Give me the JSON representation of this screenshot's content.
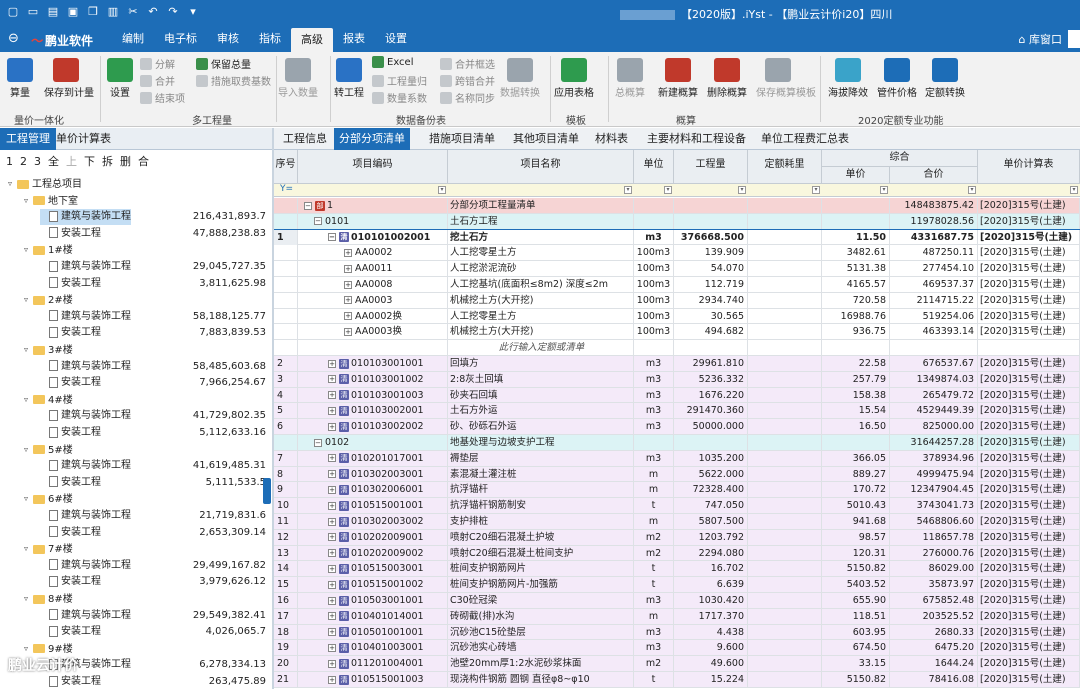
{
  "titlebar": {
    "title": "【2020版】.iYst - 【鹏业云计价i20】四川"
  },
  "menubar": {
    "logo": "鹏业软件",
    "tabs": [
      "编制",
      "电子标",
      "审核",
      "指标",
      "高级",
      "报表",
      "设置"
    ],
    "active_tab": "高级",
    "home_label": "库窗口"
  },
  "ribbon": {
    "buttons": [
      {
        "label": "算量",
        "icon": "calc-icon",
        "color": "#2a72c5"
      },
      {
        "label": "保存到计量",
        "icon": "save-to-measure-icon",
        "color": "#c0392b"
      },
      {
        "label": "设置",
        "icon": "settings-plus-icon",
        "color": "#2e9b4e"
      },
      {
        "label": "导入数量",
        "icon": "import-quantity-icon",
        "color": "#9aa4ad"
      },
      {
        "label": "转工程",
        "icon": "convert-project-icon",
        "color": "#2a72c5"
      },
      {
        "label": "数据转换",
        "icon": "data-convert-icon",
        "color": "#9aa4ad"
      },
      {
        "label": "应用表格",
        "icon": "apply-table-icon",
        "color": "#2e9b4e"
      },
      {
        "label": "总概算",
        "icon": "total-estimate-icon",
        "color": "#9aa4ad"
      },
      {
        "label": "新建概算",
        "icon": "new-estimate-icon",
        "color": "#c0392b"
      },
      {
        "label": "删除概算",
        "icon": "delete-estimate-icon",
        "color": "#c0392b"
      },
      {
        "label": "保存概算模板",
        "icon": "save-estimate-template-icon",
        "color": "#9aa4ad"
      },
      {
        "label": "海拔降效",
        "icon": "altitude-icon",
        "color": "#3aa3c9"
      },
      {
        "label": "管件价格",
        "icon": "pipe-price-icon",
        "color": "#1d6db7"
      },
      {
        "label": "定额转换",
        "icon": "quota-convert-icon",
        "color": "#1d6db7"
      }
    ],
    "small": [
      {
        "label": "分解",
        "enabled": false
      },
      {
        "label": "合并",
        "enabled": false
      },
      {
        "label": "结束项",
        "enabled": false
      },
      {
        "label": "保留总量",
        "enabled": true
      },
      {
        "label": "措施取费基数",
        "enabled": false
      },
      {
        "label": "Excel",
        "enabled": true
      },
      {
        "label": "工程量归",
        "enabled": false
      },
      {
        "label": "数量系数",
        "enabled": false
      },
      {
        "label": "合并框选",
        "enabled": false
      },
      {
        "label": "跨错合并",
        "enabled": false
      },
      {
        "label": "名称同步",
        "enabled": false
      }
    ],
    "groups": [
      "量价一体化",
      "多工程量",
      "数据备份表",
      "模板",
      "概算",
      "2020定额专业功能"
    ]
  },
  "left": {
    "tabs": [
      "工程管理",
      "单价计算表"
    ],
    "toolbar": [
      "1",
      "2",
      "3",
      "全",
      "上",
      "下",
      "拆",
      "删",
      "合"
    ],
    "tree": [
      {
        "level": 0,
        "label": "工程总项目",
        "type": "folder",
        "value": ""
      },
      {
        "level": 1,
        "label": "地下室",
        "type": "folder",
        "value": ""
      },
      {
        "level": 2,
        "label": "建筑与装饰工程",
        "type": "file",
        "value": "216,431,893.7",
        "selected": true
      },
      {
        "level": 2,
        "label": "安装工程",
        "type": "file",
        "value": "47,888,238.83"
      },
      {
        "level": 1,
        "label": "1#楼",
        "type": "folder",
        "value": ""
      },
      {
        "level": 2,
        "label": "建筑与装饰工程",
        "type": "file",
        "value": "29,045,727.35"
      },
      {
        "level": 2,
        "label": "安装工程",
        "type": "file",
        "value": "3,811,625.98"
      },
      {
        "level": 1,
        "label": "2#楼",
        "type": "folder",
        "value": ""
      },
      {
        "level": 2,
        "label": "建筑与装饰工程",
        "type": "file",
        "value": "58,188,125.77"
      },
      {
        "level": 2,
        "label": "安装工程",
        "type": "file",
        "value": "7,883,839.53"
      },
      {
        "level": 1,
        "label": "3#楼",
        "type": "folder",
        "value": ""
      },
      {
        "level": 2,
        "label": "建筑与装饰工程",
        "type": "file",
        "value": "58,485,603.68"
      },
      {
        "level": 2,
        "label": "安装工程",
        "type": "file",
        "value": "7,966,254.67"
      },
      {
        "level": 1,
        "label": "4#楼",
        "type": "folder",
        "value": ""
      },
      {
        "level": 2,
        "label": "建筑与装饰工程",
        "type": "file",
        "value": "41,729,802.35"
      },
      {
        "level": 2,
        "label": "安装工程",
        "type": "file",
        "value": "5,112,633.16"
      },
      {
        "level": 1,
        "label": "5#楼",
        "type": "folder",
        "value": ""
      },
      {
        "level": 2,
        "label": "建筑与装饰工程",
        "type": "file",
        "value": "41,619,485.31"
      },
      {
        "level": 2,
        "label": "安装工程",
        "type": "file",
        "value": "5,111,533.5"
      },
      {
        "level": 1,
        "label": "6#楼",
        "type": "folder",
        "value": ""
      },
      {
        "level": 2,
        "label": "建筑与装饰工程",
        "type": "file",
        "value": "21,719,831.6"
      },
      {
        "level": 2,
        "label": "安装工程",
        "type": "file",
        "value": "2,653,309.14"
      },
      {
        "level": 1,
        "label": "7#楼",
        "type": "folder",
        "value": ""
      },
      {
        "level": 2,
        "label": "建筑与装饰工程",
        "type": "file",
        "value": "29,499,167.82"
      },
      {
        "level": 2,
        "label": "安装工程",
        "type": "file",
        "value": "3,979,626.12"
      },
      {
        "level": 1,
        "label": "8#楼",
        "type": "folder",
        "value": ""
      },
      {
        "level": 2,
        "label": "建筑与装饰工程",
        "type": "file",
        "value": "29,549,382.41"
      },
      {
        "level": 2,
        "label": "安装工程",
        "type": "file",
        "value": "4,026,065.7"
      },
      {
        "level": 1,
        "label": "9#楼",
        "type": "folder",
        "value": ""
      },
      {
        "level": 2,
        "label": "建筑与装饰工程",
        "type": "file",
        "value": "6,278,334.13"
      },
      {
        "level": 2,
        "label": "安装工程",
        "type": "file",
        "value": "263,475.89"
      }
    ]
  },
  "grid": {
    "tabs": [
      "工程信息",
      "分部分项清单",
      "措施项目清单",
      "其他项目清单",
      "材料表",
      "主要材料和工程设备",
      "单位工程费汇总表"
    ],
    "active_tab": "分部分项清单",
    "headers": {
      "seq": "序号",
      "code": "项目编码",
      "name": "项目名称",
      "unit": "单位",
      "qty": "工程量",
      "quota": "定额耗里",
      "synth": "综合",
      "unit_price": "单价",
      "total": "合价",
      "calc": "单价计算表"
    },
    "rows": [
      {
        "seq": "",
        "code": "1",
        "name": "分部分项工程量清单",
        "unit": "",
        "qty": "",
        "price": "",
        "total": "148483875.42",
        "calc": "[2020]315号(土建)",
        "kind": "root"
      },
      {
        "seq": "",
        "code": "0101",
        "name": "土石方工程",
        "unit": "",
        "qty": "",
        "price": "",
        "total": "11978028.56",
        "calc": "[2020]315号(土建)",
        "kind": "section"
      },
      {
        "seq": "1",
        "code": "010101002001",
        "name": "挖土石方",
        "unit": "m3",
        "qty": "376668.500",
        "price": "11.50",
        "total": "4331687.75",
        "calc": "[2020]315号(土建)",
        "kind": "current"
      },
      {
        "seq": "",
        "code": "AA0002",
        "name": "人工挖零星土方",
        "unit": "100m3",
        "qty": "139.909",
        "price": "3482.61",
        "total": "487250.11",
        "calc": "[2020]315号(土建)",
        "kind": "sub"
      },
      {
        "seq": "",
        "code": "AA0011",
        "name": "人工挖淤泥流砂",
        "unit": "100m3",
        "qty": "54.070",
        "price": "5131.38",
        "total": "277454.10",
        "calc": "[2020]315号(土建)",
        "kind": "sub"
      },
      {
        "seq": "",
        "code": "AA0008",
        "name": "人工挖基坑(底面积≤8m2) 深度≤2m",
        "unit": "100m3",
        "qty": "112.719",
        "price": "4165.57",
        "total": "469537.37",
        "calc": "[2020]315号(土建)",
        "kind": "sub"
      },
      {
        "seq": "",
        "code": "AA0003",
        "name": "机械挖土方(大开挖)",
        "unit": "100m3",
        "qty": "2934.740",
        "price": "720.58",
        "total": "2114715.22",
        "calc": "[2020]315号(土建)",
        "kind": "sub"
      },
      {
        "seq": "",
        "code": "AA0002换",
        "name": "人工挖零星土方",
        "unit": "100m3",
        "qty": "30.565",
        "price": "16988.76",
        "total": "519254.06",
        "calc": "[2020]315号(土建)",
        "kind": "sub"
      },
      {
        "seq": "",
        "code": "AA0003换",
        "name": "机械挖土方(大开挖)",
        "unit": "100m3",
        "qty": "494.682",
        "price": "936.75",
        "total": "463393.14",
        "calc": "[2020]315号(土建)",
        "kind": "sub"
      },
      {
        "seq": "",
        "code": "",
        "name": "此行输入定额或清单",
        "unit": "",
        "qty": "",
        "price": "",
        "total": "",
        "calc": "",
        "kind": "input"
      },
      {
        "seq": "2",
        "code": "010103001001",
        "name": "回填方",
        "unit": "m3",
        "qty": "29961.810",
        "price": "22.58",
        "total": "676537.67",
        "calc": "[2020]315号(土建)",
        "kind": "item"
      },
      {
        "seq": "3",
        "code": "010103001002",
        "name": "2:8灰土回填",
        "unit": "m3",
        "qty": "5236.332",
        "price": "257.79",
        "total": "1349874.03",
        "calc": "[2020]315号(土建)",
        "kind": "item"
      },
      {
        "seq": "4",
        "code": "010103001003",
        "name": "砂夹石回填",
        "unit": "m3",
        "qty": "1676.220",
        "price": "158.38",
        "total": "265479.72",
        "calc": "[2020]315号(土建)",
        "kind": "item"
      },
      {
        "seq": "5",
        "code": "010103002001",
        "name": "土石方外运",
        "unit": "m3",
        "qty": "291470.360",
        "price": "15.54",
        "total": "4529449.39",
        "calc": "[2020]315号(土建)",
        "kind": "item"
      },
      {
        "seq": "6",
        "code": "010103002002",
        "name": "砂、砂砾石外运",
        "unit": "m3",
        "qty": "50000.000",
        "price": "16.50",
        "total": "825000.00",
        "calc": "[2020]315号(土建)",
        "kind": "item"
      },
      {
        "seq": "",
        "code": "0102",
        "name": "地基处理与边坡支护工程",
        "unit": "",
        "qty": "",
        "price": "",
        "total": "31644257.28",
        "calc": "[2020]315号(土建)",
        "kind": "section"
      },
      {
        "seq": "7",
        "code": "010201017001",
        "name": "褥垫层",
        "unit": "m3",
        "qty": "1035.200",
        "price": "366.05",
        "total": "378934.96",
        "calc": "[2020]315号(土建)",
        "kind": "item"
      },
      {
        "seq": "8",
        "code": "010302003001",
        "name": "素混凝土灌注桩",
        "unit": "m",
        "qty": "5622.000",
        "price": "889.27",
        "total": "4999475.94",
        "calc": "[2020]315号(土建)",
        "kind": "item"
      },
      {
        "seq": "9",
        "code": "010302006001",
        "name": "抗浮锚杆",
        "unit": "m",
        "qty": "72328.400",
        "price": "170.72",
        "total": "12347904.45",
        "calc": "[2020]315号(土建)",
        "kind": "item"
      },
      {
        "seq": "10",
        "code": "010515001001",
        "name": "抗浮锚杆钢筋制安",
        "unit": "t",
        "qty": "747.050",
        "price": "5010.43",
        "total": "3743041.73",
        "calc": "[2020]315号(土建)",
        "kind": "item"
      },
      {
        "seq": "11",
        "code": "010302003002",
        "name": "支护排桩",
        "unit": "m",
        "qty": "5807.500",
        "price": "941.68",
        "total": "5468806.60",
        "calc": "[2020]315号(土建)",
        "kind": "item"
      },
      {
        "seq": "12",
        "code": "010202009001",
        "name": "喷射C20细石混凝土护坡",
        "unit": "m2",
        "qty": "1203.792",
        "price": "98.57",
        "total": "118657.78",
        "calc": "[2020]315号(土建)",
        "kind": "item"
      },
      {
        "seq": "13",
        "code": "010202009002",
        "name": "喷射C20细石混凝土桩间支护",
        "unit": "m2",
        "qty": "2294.080",
        "price": "120.31",
        "total": "276000.76",
        "calc": "[2020]315号(土建)",
        "kind": "item"
      },
      {
        "seq": "14",
        "code": "010515003001",
        "name": "桩间支护钢筋网片",
        "unit": "t",
        "qty": "16.702",
        "price": "5150.82",
        "total": "86029.00",
        "calc": "[2020]315号(土建)",
        "kind": "item"
      },
      {
        "seq": "15",
        "code": "010515001002",
        "name": "桩间支护钢筋网片-加强筋",
        "unit": "t",
        "qty": "6.639",
        "price": "5403.52",
        "total": "35873.97",
        "calc": "[2020]315号(土建)",
        "kind": "item"
      },
      {
        "seq": "16",
        "code": "010503001001",
        "name": "C30砼冠梁",
        "unit": "m3",
        "qty": "1030.420",
        "price": "655.90",
        "total": "675852.48",
        "calc": "[2020]315号(土建)",
        "kind": "item"
      },
      {
        "seq": "17",
        "code": "010401014001",
        "name": "砖砌截(排)水沟",
        "unit": "m",
        "qty": "1717.370",
        "price": "118.51",
        "total": "203525.52",
        "calc": "[2020]315号(土建)",
        "kind": "item"
      },
      {
        "seq": "18",
        "code": "010501001001",
        "name": "沉砂池C15砼垫层",
        "unit": "m3",
        "qty": "4.438",
        "price": "603.95",
        "total": "2680.33",
        "calc": "[2020]315号(土建)",
        "kind": "item"
      },
      {
        "seq": "19",
        "code": "010401003001",
        "name": "沉砂池实心砖墙",
        "unit": "m3",
        "qty": "9.600",
        "price": "674.50",
        "total": "6475.20",
        "calc": "[2020]315号(土建)",
        "kind": "item"
      },
      {
        "seq": "20",
        "code": "011201004001",
        "name": "池壁20mm厚1:2水泥砂浆抹面",
        "unit": "m2",
        "qty": "49.600",
        "price": "33.15",
        "total": "1644.24",
        "calc": "[2020]315号(土建)",
        "kind": "item"
      },
      {
        "seq": "21",
        "code": "010515001003",
        "name": "现浇构件钢筋 圆钢 直径φ8~φ10",
        "unit": "t",
        "qty": "15.224",
        "price": "5150.82",
        "total": "78416.08",
        "calc": "[2020]315号(土建)",
        "kind": "item"
      }
    ]
  },
  "watermark": "鹏业云计价"
}
